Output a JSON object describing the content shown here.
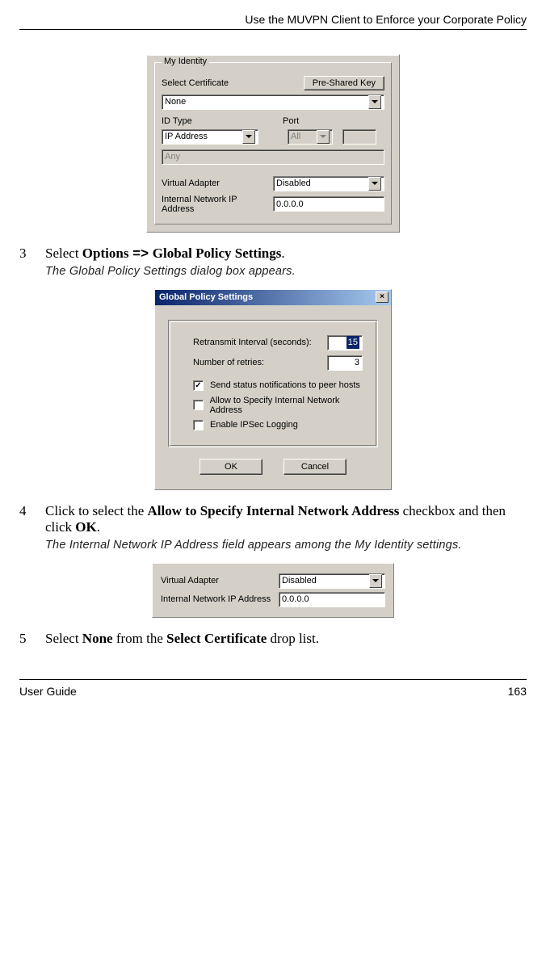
{
  "header": {
    "title": "Use the MUVPN Client to Enforce your Corporate Policy"
  },
  "footer": {
    "left": "User Guide",
    "page": "163"
  },
  "identity_panel": {
    "group_label": "My Identity",
    "select_cert_label": "Select Certificate",
    "psk_button": "Pre-Shared Key",
    "cert_value": "None",
    "id_type_label": "ID Type",
    "id_type_value": "IP Address",
    "port_label": "Port",
    "port_value": "All",
    "any_label": "Any",
    "va_label": "Virtual Adapter",
    "va_value": "Disabled",
    "ip_label": "Internal Network IP Address",
    "ip_value": "0.0.0.0"
  },
  "step3": {
    "num": "3",
    "pre": "Select ",
    "bold1": "Options",
    "arrow": " => ",
    "bold2": "Global Policy Settings",
    "post": ".",
    "result": "The Global Policy Settings dialog box appears."
  },
  "gps_dialog": {
    "title": "Global Policy Settings",
    "retransmit_label": "Retransmit Interval (seconds):",
    "retransmit_value": "15",
    "retries_label": "Number of retries:",
    "retries_value": "3",
    "chk1": "Send status notifications to peer hosts",
    "chk2": "Allow to Specify Internal Network Address",
    "chk3": "Enable IPSec Logging",
    "ok": "OK",
    "cancel": "Cancel"
  },
  "step4": {
    "num": "4",
    "pre": "Click to select the ",
    "bold1": "Allow to Specify Internal Network Address",
    "mid": " checkbox and then click ",
    "bold2": "OK",
    "post": ".",
    "result": "The Internal Network IP Address field appears among the My Identity settings."
  },
  "small_panel": {
    "va_label": "Virtual Adapter",
    "va_value": "Disabled",
    "ip_label": "Internal Network IP Address",
    "ip_value": "0.0.0.0"
  },
  "step5": {
    "num": "5",
    "pre": "Select ",
    "bold1": "None",
    "mid": " from the ",
    "bold2": "Select Certificate",
    "post": " drop list."
  }
}
